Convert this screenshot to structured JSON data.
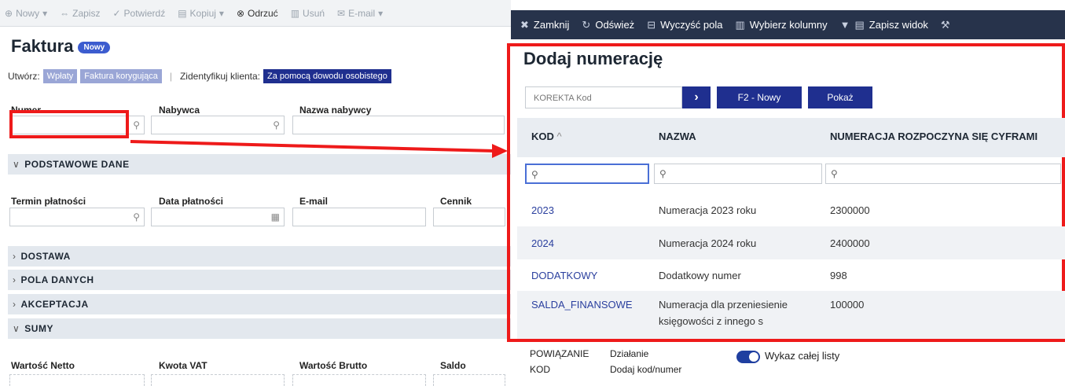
{
  "left_toolbar": {
    "items": [
      "Nowy",
      "Zapisz",
      "Potwierdź",
      "Kopiuj",
      "Odrzuć",
      "Usuń",
      "E-mail"
    ]
  },
  "form": {
    "title": "Faktura",
    "badge": "Nowy",
    "create_label": "Utwórz:",
    "create_wplaty": "Wpłaty",
    "create_korekta": "Faktura korygująca",
    "identify_label": "Zidentyfikuj klienta:",
    "identify_button": "Za pomocą dowodu osobistego",
    "fields_row1": {
      "numer": "Numer",
      "nabywca": "Nabywca",
      "nazwa_nabywcy": "Nazwa nabywcy"
    },
    "section_podstawowe": "PODSTAWOWE DANE",
    "fields_row2": {
      "termin": "Termin płatności",
      "data": "Data płatności",
      "email": "E-mail",
      "cennik": "Cennik"
    },
    "section_dostawa": "DOSTAWA",
    "section_pola": "POLA DANYCH",
    "section_akceptacja": "AKCEPTACJA",
    "section_sumy": "SUMY",
    "fields_row3": {
      "netto": "Wartość Netto",
      "vat": "Kwota VAT",
      "brutto": "Wartość Brutto",
      "saldo": "Saldo"
    }
  },
  "dialog": {
    "toolbar": {
      "zamknij": "Zamknij",
      "odswiez": "Odśwież",
      "wyczysc": "Wyczyść pola",
      "wybierz": "Wybierz kolumny",
      "zapisz": "Zapisz widok"
    },
    "title": "Dodaj numerację",
    "kod_placeholder": "KOREKTA Kod",
    "btn_f2": "F2 - Nowy",
    "btn_pokaz": "Pokaż",
    "columns": {
      "kod": "KOD",
      "nazwa": "NAZWA",
      "numeracja": "NUMERACJA ROZPOCZYNA SIĘ CYFRAMI"
    },
    "rows": [
      {
        "kod": "2023",
        "nazwa": "Numeracja 2023 roku",
        "numeracja": "2300000"
      },
      {
        "kod": "2024",
        "nazwa": "Numeracja 2024 roku",
        "numeracja": "2400000"
      },
      {
        "kod": "DODATKOWY",
        "nazwa": "Dodatkowy numer",
        "numeracja": "998"
      },
      {
        "kod": "SALDA_FINANSOWE",
        "nazwa": "Numeracja dla przeniesienie",
        "nazwa2": "księgowości z innego s",
        "numeracja": "100000"
      }
    ],
    "footer": {
      "powiazanie": "POWIĄZANIE",
      "kod": "KOD",
      "dzialanie": "Działanie",
      "dodaj": "Dodaj kod/numer",
      "toggle_label": "Wykaz całej listy"
    }
  },
  "colors": {
    "highlight": "#ee1a1a",
    "dialog_toolbar": "#27334b",
    "primary": "#1f2f8f",
    "link": "#2a3f9e"
  }
}
